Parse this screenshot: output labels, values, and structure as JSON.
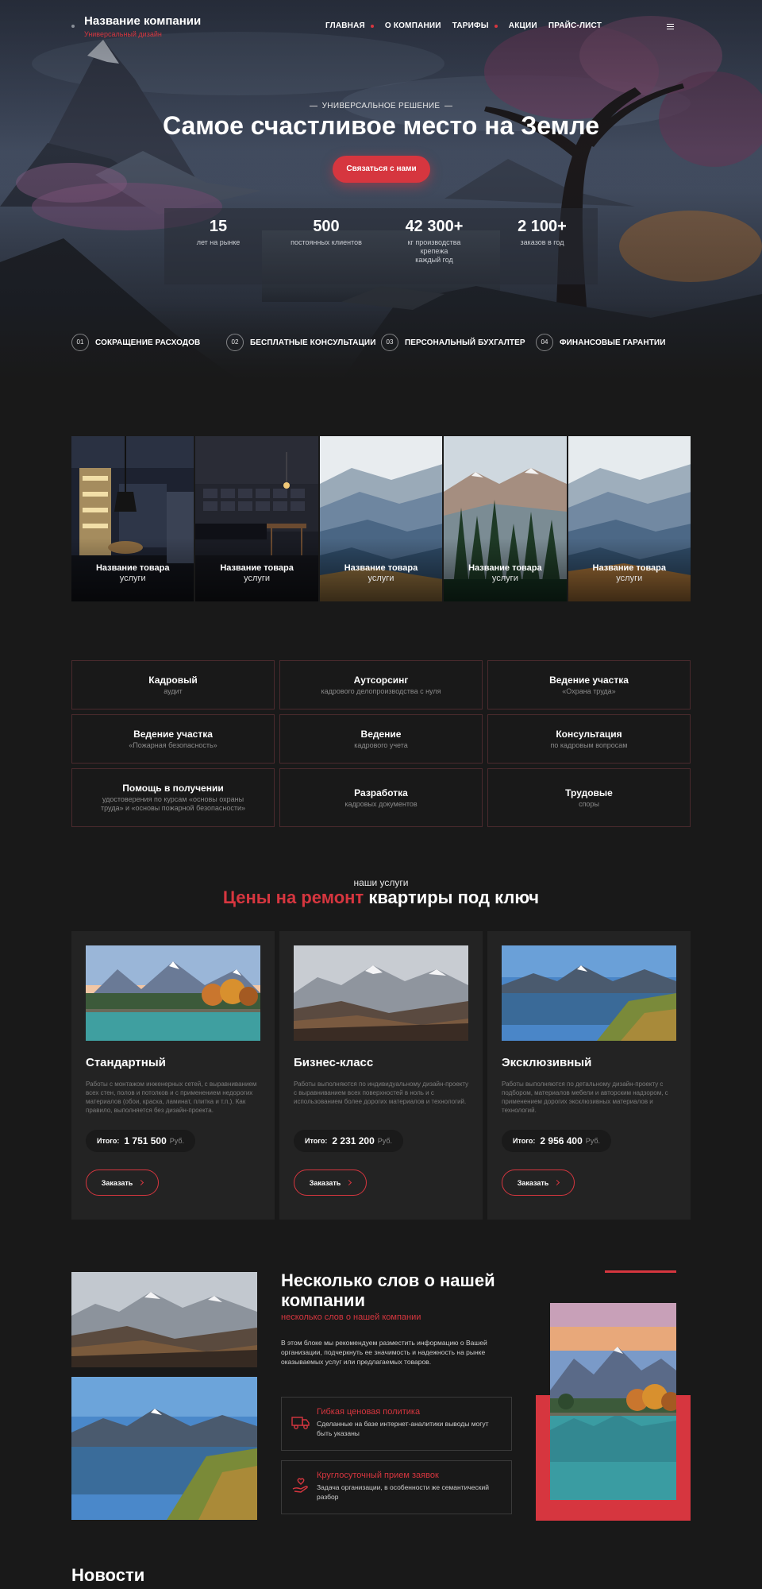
{
  "header": {
    "company_name": "Название компании",
    "company_tagline": "Универсальный дизайн",
    "nav": [
      {
        "label": "ГЛАВНАЯ",
        "dropdown": true
      },
      {
        "label": "О КОМПАНИИ",
        "dropdown": false
      },
      {
        "label": "ТАРИФЫ",
        "dropdown": true
      },
      {
        "label": "АКЦИИ",
        "dropdown": false
      },
      {
        "label": "ПРАЙС-ЛИСТ",
        "dropdown": false
      }
    ],
    "menu_icon": "hamburger-icon"
  },
  "hero": {
    "eyebrow": "УНИВЕРСАЛЬНОЕ РЕШЕНИЕ",
    "title": "Самое счастливое место на Земле",
    "cta_label": "Связаться с нами",
    "stats": [
      {
        "value": "15",
        "label": "лет на рынке"
      },
      {
        "value": "500",
        "label": "постоянных клиентов"
      },
      {
        "value": "42 300+",
        "label": "кг производства крепежа каждый год"
      },
      {
        "value": "2 100+",
        "label": "заказов в год"
      }
    ],
    "features": [
      {
        "num": "01",
        "label": "СОКРАЩЕНИЕ РАСХОДОВ"
      },
      {
        "num": "02",
        "label": "БЕСПЛАТНЫЕ КОНСУЛЬТАЦИИ"
      },
      {
        "num": "03",
        "label": "ПЕРСОНАЛЬНЫЙ БУХГАЛТЕР"
      },
      {
        "num": "04",
        "label": "ФИНАНСОВЫЕ ГАРАНТИИ"
      }
    ]
  },
  "products": [
    {
      "title": "Название товара",
      "subtitle": "услуги"
    },
    {
      "title": "Название товара",
      "subtitle": "услуги"
    },
    {
      "title": "Название товара",
      "subtitle": "услуги"
    },
    {
      "title": "Название товара",
      "subtitle": "услуги"
    },
    {
      "title": "Название товара",
      "subtitle": "услуги"
    }
  ],
  "services": [
    {
      "title": "Кадровый",
      "subtitle": "аудит"
    },
    {
      "title": "Аутсорсинг",
      "subtitle": "кадрового делопроизводства с нуля"
    },
    {
      "title": "Ведение участка",
      "subtitle": "«Охрана труда»"
    },
    {
      "title": "Ведение участка",
      "subtitle": "«Пожарная безопасность»"
    },
    {
      "title": "Ведение",
      "subtitle": "кадрового учета"
    },
    {
      "title": "Консультация",
      "subtitle": "по кадровым вопросам"
    },
    {
      "title": "Помощь в получении",
      "subtitle": "удостоверения по курсам «основы охраны труда» и «основы пожарной безопасности»"
    },
    {
      "title": "Разработка",
      "subtitle": "кадровых документов"
    },
    {
      "title": "Трудовые",
      "subtitle": "споры"
    }
  ],
  "prices": {
    "eyebrow": "наши услуги",
    "title_red": "Цены на ремонт",
    "title_rest": " квартиры под ключ",
    "cards": [
      {
        "name": "Стандартный",
        "desc": "Работы с монтажом инженерных сетей, с выравниванием всех стен, полов и потолков и с применением недорогих материалов (обои, краска, ламинат, плитка и т.п.). Как правило, выполняется без дизайн-проекта.",
        "total_label": "Итого:",
        "total": "1 751 500",
        "currency": "Руб.",
        "order_label": "Заказать"
      },
      {
        "name": "Бизнес-класс",
        "desc": "Работы выполняются по индивидуальному дизайн-проекту с выравниванием всех поверхностей в ноль и с использованием более дорогих материалов и технологий.",
        "total_label": "Итого:",
        "total": "2 231 200",
        "currency": "Руб.",
        "order_label": "Заказать"
      },
      {
        "name": "Эксклюзивный",
        "desc": "Работы выполняются по детальному дизайн-проекту с подбором, материалов мебели и авторским надзором, с применением дорогих эксклюзивных материалов и технологий.",
        "total_label": "Итого:",
        "total": "2 956 400",
        "currency": "Руб.",
        "order_label": "Заказать"
      }
    ]
  },
  "about": {
    "title": "Несколько слов о нашей компании",
    "subtitle": "несколько слов о нашей компании",
    "text": "В этом блоке мы рекомендуем разместить информацию о Вашей организации, подчеркнуть ее значимость и надежность на рынке оказываемых услуг или предлагаемых товаров.",
    "features": [
      {
        "title": "Гибкая ценовая политика",
        "desc": "Сделанные на базе интернет-аналитики выводы могут быть указаны",
        "icon": "truck-icon"
      },
      {
        "title": "Круглосуточный прием заявок",
        "desc": "Задача организации, в особенности же семантический разбор",
        "icon": "hand-icon"
      }
    ]
  },
  "news": {
    "title": "Новости"
  },
  "colors": {
    "accent": "#d6363f",
    "background": "#191919",
    "card": "#232323"
  }
}
